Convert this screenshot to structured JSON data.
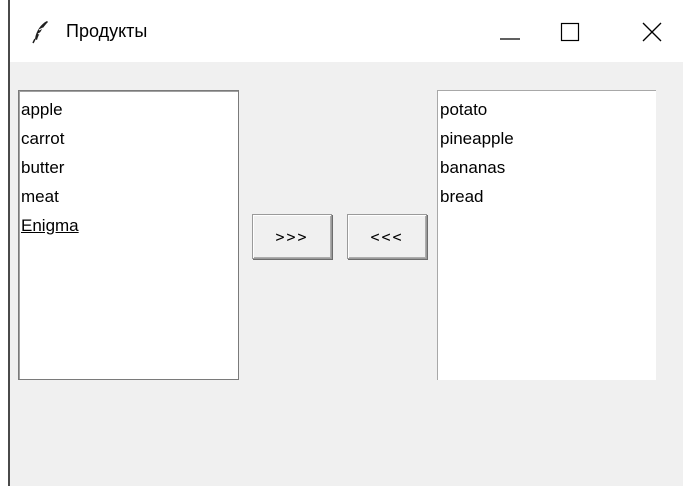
{
  "window": {
    "title": "Продукты",
    "icon": "feather-icon",
    "controls": [
      "minimize-icon",
      "maximize-icon",
      "close-icon"
    ]
  },
  "left_list": {
    "items": [
      "apple",
      "carrot",
      "butter",
      "meat",
      "Enigma"
    ],
    "active_item": "Enigma"
  },
  "buttons": {
    "move_right_label": ">>>",
    "move_left_label": "<<<"
  },
  "right_list": {
    "items": [
      "potato",
      "pineapple",
      "bananas",
      "bread"
    ]
  }
}
